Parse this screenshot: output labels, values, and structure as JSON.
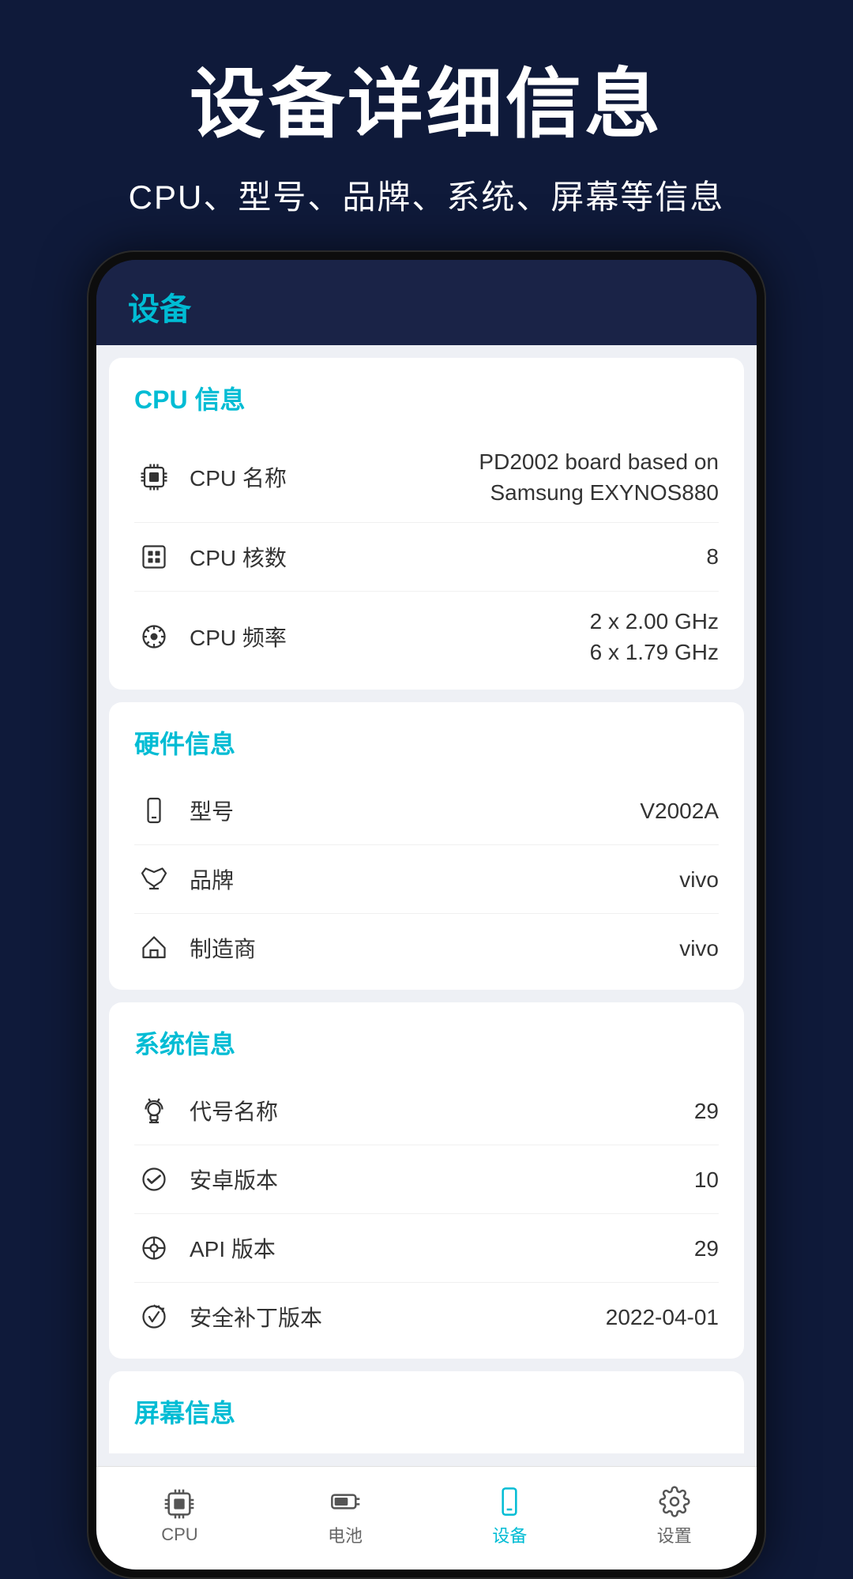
{
  "header": {
    "title": "设备详细信息",
    "subtitle": "CPU、型号、品牌、系统、屏幕等信息"
  },
  "app": {
    "topbar_title": "设备",
    "sections": [
      {
        "id": "cpu",
        "title": "CPU 信息",
        "rows": [
          {
            "label": "CPU 名称",
            "value": "PD2002 board based on Samsung EXYNOS880",
            "icon": "cpu"
          },
          {
            "label": "CPU 核数",
            "value": "8",
            "icon": "cpu-cores"
          },
          {
            "label": "CPU 频率",
            "value": "2 x 2.00 GHz\n6 x 1.79 GHz",
            "icon": "cpu-freq"
          }
        ]
      },
      {
        "id": "hardware",
        "title": "硬件信息",
        "rows": [
          {
            "label": "型号",
            "value": "V2002A",
            "icon": "phone"
          },
          {
            "label": "品牌",
            "value": "vivo",
            "icon": "crown"
          },
          {
            "label": "制造商",
            "value": "vivo",
            "icon": "home"
          }
        ]
      },
      {
        "id": "system",
        "title": "系统信息",
        "rows": [
          {
            "label": "代号名称",
            "value": "29",
            "icon": "android"
          },
          {
            "label": "安卓版本",
            "value": "10",
            "icon": "android-check"
          },
          {
            "label": "API 版本",
            "value": "29",
            "icon": "api"
          },
          {
            "label": "安全补丁版本",
            "value": "2022-04-01",
            "icon": "security"
          }
        ]
      },
      {
        "id": "screen",
        "title": "屏幕信息",
        "rows": []
      }
    ],
    "nav": [
      {
        "id": "cpu",
        "label": "CPU",
        "icon": "cpu-nav",
        "active": false
      },
      {
        "id": "battery",
        "label": "电池",
        "icon": "battery-nav",
        "active": false
      },
      {
        "id": "device",
        "label": "设备",
        "icon": "device-nav",
        "active": true
      },
      {
        "id": "settings",
        "label": "设置",
        "icon": "settings-nav",
        "active": false
      }
    ]
  }
}
